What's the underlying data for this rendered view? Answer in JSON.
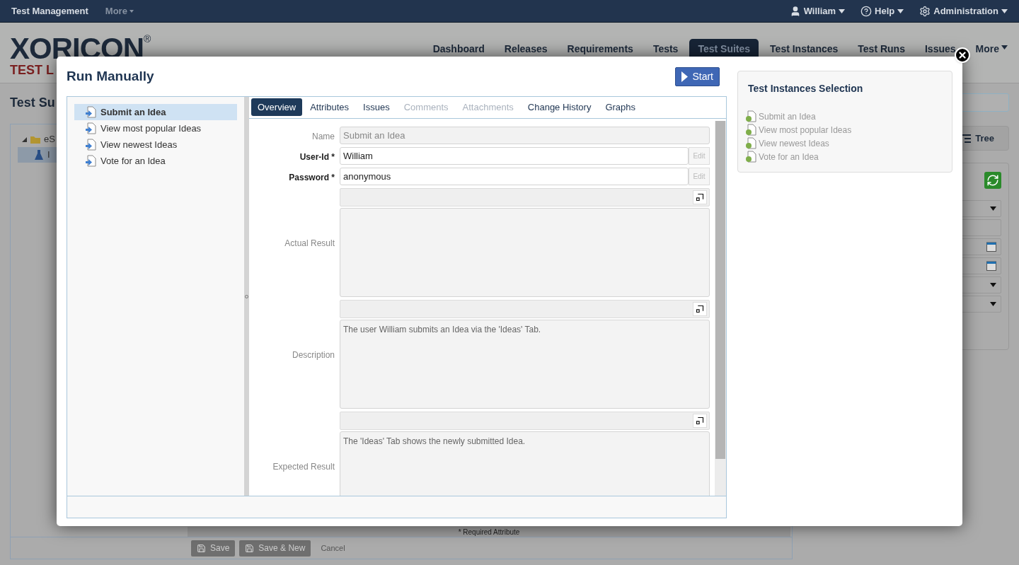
{
  "top_bar": {
    "app": "Test Management",
    "more": "More",
    "user": "William",
    "help": "Help",
    "admin": "Administration"
  },
  "logo": {
    "name": "XORICON",
    "mark": "®",
    "tagline": "TEST L"
  },
  "nav": [
    {
      "label": "Dashboard",
      "selected": false
    },
    {
      "label": "Releases",
      "selected": false
    },
    {
      "label": "Requirements",
      "selected": false
    },
    {
      "label": "Tests",
      "selected": false
    },
    {
      "label": "Test Suites",
      "selected": true
    },
    {
      "label": "Test Instances",
      "selected": false
    },
    {
      "label": "Test Runs",
      "selected": false
    },
    {
      "label": "Issues",
      "selected": false
    },
    {
      "label": "More",
      "selected": false
    }
  ],
  "page": {
    "title": "Test Su",
    "tree": [
      {
        "label": "eS",
        "expanded": true,
        "children": [
          {
            "label": "I",
            "selected": true
          }
        ]
      }
    ],
    "tree_button": "Tree",
    "required_note": "* Required Attribute",
    "buttons": [
      {
        "label": "Save",
        "kind": "save"
      },
      {
        "label": "Save & New",
        "kind": "save"
      },
      {
        "label": "Cancel",
        "kind": "link"
      }
    ]
  },
  "dialog": {
    "title": "Run Manually",
    "start": "Start",
    "steps": [
      {
        "label": "Submit an Idea",
        "selected": true
      },
      {
        "label": "View most popular Ideas",
        "selected": false
      },
      {
        "label": "View newest Ideas",
        "selected": false
      },
      {
        "label": "Vote for an Idea",
        "selected": false
      }
    ],
    "tabs": [
      {
        "label": "Overview",
        "selected": true,
        "disabled": false
      },
      {
        "label": "Attributes",
        "selected": false,
        "disabled": false
      },
      {
        "label": "Issues",
        "selected": false,
        "disabled": false
      },
      {
        "label": "Comments",
        "selected": false,
        "disabled": true
      },
      {
        "label": "Attachments",
        "selected": false,
        "disabled": true
      },
      {
        "label": "Change History",
        "selected": false,
        "disabled": false
      },
      {
        "label": "Graphs",
        "selected": false,
        "disabled": false
      }
    ],
    "fields": [
      {
        "kind": "readonly",
        "label": "Name",
        "required": false,
        "value": "Submit an Idea"
      },
      {
        "kind": "editable",
        "label": "User-Id *",
        "required": true,
        "value": "William",
        "edit": "Edit"
      },
      {
        "kind": "editable",
        "label": "Password *",
        "required": true,
        "value": "anonymous",
        "edit": "Edit"
      },
      {
        "kind": "richtext",
        "label": "Actual Result",
        "required": false
      },
      {
        "kind": "richtext",
        "label": "Description",
        "required": false,
        "value": "The user William submits an Idea via the 'Ideas' Tab."
      },
      {
        "kind": "richtext",
        "label": "Expected Result",
        "required": false,
        "value": "The 'Ideas' Tab shows the newly submitted Idea."
      }
    ],
    "selection": {
      "title": "Test Instances Selection",
      "items": [
        "Submit an Idea",
        "View most popular Ideas",
        "View newest Ideas",
        "Vote for an Idea"
      ]
    }
  }
}
